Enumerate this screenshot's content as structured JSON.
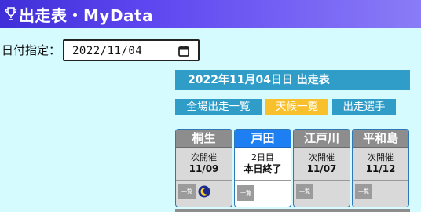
{
  "header": {
    "title": "出走表・MyData",
    "icon": "trophy-icon"
  },
  "date_picker": {
    "label": "日付指定：",
    "value": "2022/11/04",
    "icon": "calendar-icon"
  },
  "date_heading": "2022年11月04日日 出走表",
  "nav": [
    {
      "label": "全場出走一覧",
      "active": false
    },
    {
      "label": "天候一覧",
      "active": true
    },
    {
      "label": "出走選手",
      "active": false
    }
  ],
  "venues": [
    {
      "name": "桐生",
      "line1": "次開催",
      "line2": "11/09",
      "button": "一覧",
      "night": true,
      "today": false
    },
    {
      "name": "戸田",
      "line1": "2日目",
      "line2": "本日終了",
      "button": "一覧",
      "night": false,
      "today": true
    },
    {
      "name": "江戸川",
      "line1": "次開催",
      "line2": "11/07",
      "button": "一覧",
      "night": false,
      "today": false
    },
    {
      "name": "平和島",
      "line1": "次開催",
      "line2": "11/12",
      "button": "一覧",
      "night": false,
      "today": false
    }
  ],
  "colors": {
    "background": "#d6fbff",
    "header_gradient_start": "#3f2fd8",
    "accent_blue": "#2f9dc8",
    "active_tab": "#f8c02c",
    "today_venue": "#1e7ff2",
    "closed_venue": "#8d8d8d"
  }
}
